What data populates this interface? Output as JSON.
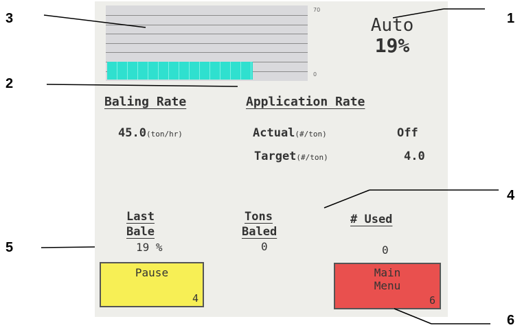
{
  "gauge": {
    "max_label": "70",
    "min_label": "0",
    "level_percent": 19
  },
  "mode": {
    "label": "Auto",
    "value": "19%"
  },
  "baling_rate": {
    "header": "Baling Rate",
    "value": "45.0",
    "unit": "(ton/hr)"
  },
  "application_rate": {
    "header": "Application Rate",
    "actual_label": "Actual",
    "actual_unit": "(#/ton)",
    "actual_value": "Off",
    "target_label": "Target",
    "target_unit": "(#/ton)",
    "target_value": "4.0"
  },
  "stats": {
    "last_bale": {
      "label_line1": "Last",
      "label_line2": "Bale",
      "value": "19 %"
    },
    "tons_baled": {
      "label_line1": "Tons",
      "label_line2": "Baled",
      "value": "0"
    },
    "used": {
      "label": "# Used",
      "value": "0"
    }
  },
  "buttons": {
    "pause": {
      "label": "Pause",
      "number": "4",
      "color": "#f7ef55"
    },
    "main_menu": {
      "label_line1": "Main",
      "label_line2": "Menu",
      "number": "6",
      "color": "#e9504e"
    }
  },
  "callouts": [
    "1",
    "2",
    "3",
    "4",
    "5",
    "6"
  ]
}
